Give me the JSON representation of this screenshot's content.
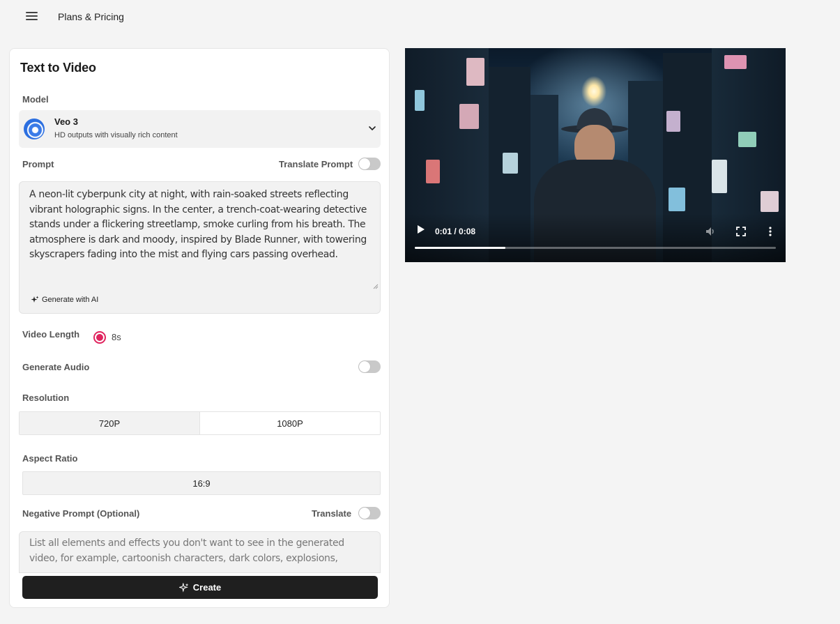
{
  "topbar": {
    "nav_link": "Plans & Pricing"
  },
  "panel": {
    "title": "Text to Video",
    "model": {
      "label": "Model",
      "name": "Veo 3",
      "description": "HD outputs with visually rich content"
    },
    "prompt": {
      "label": "Prompt",
      "translate_label": "Translate Prompt",
      "translate_on": false,
      "value": "A neon-lit cyberpunk city at night, with rain-soaked streets reflecting vibrant holographic signs. In the center, a trench-coat-wearing detective stands under a flickering streetlamp, smoke curling from his breath. The atmosphere is dark and moody, inspired by Blade Runner, with towering skyscrapers fading into the mist and flying cars passing overhead.",
      "generate_ai_label": "Generate with AI"
    },
    "video_length": {
      "label": "Video Length",
      "option": "8s",
      "selected": true
    },
    "generate_audio": {
      "label": "Generate Audio",
      "on": false
    },
    "resolution": {
      "label": "Resolution",
      "options": [
        "720P",
        "1080P"
      ],
      "selected": "720P"
    },
    "aspect_ratio": {
      "label": "Aspect Ratio",
      "value": "16:9"
    },
    "negative_prompt": {
      "label": "Negative Prompt (Optional)",
      "translate_label": "Translate",
      "translate_on": false,
      "placeholder": "List all elements and effects you don't want to see in the generated video, for example, cartoonish characters, dark colors, explosions,"
    },
    "create_label": "Create"
  },
  "video": {
    "time": "0:01 / 0:08",
    "progress": 0.25,
    "icons": [
      "play-icon",
      "volume-icon",
      "fullscreen-icon",
      "more-vertical-icon"
    ]
  },
  "colors": {
    "accent": "#e0245e",
    "button": "#1f1f1f",
    "background": "#f4f4f4"
  }
}
